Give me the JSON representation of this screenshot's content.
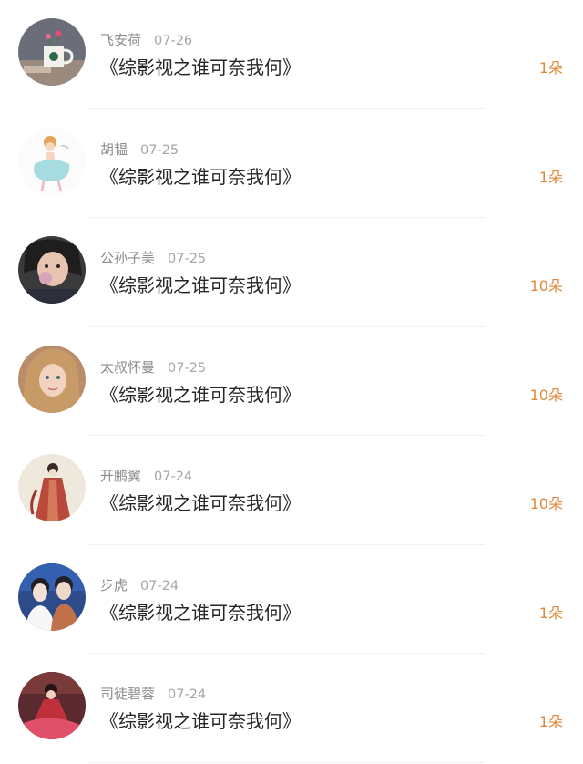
{
  "items": [
    {
      "name": "飞安荷",
      "date": "07-26",
      "title": "《综影视之谁可奈我何》",
      "count": "1朵",
      "avatar": "avatar-coffee-cup-icon"
    },
    {
      "name": "胡韫",
      "date": "07-25",
      "title": "《综影视之谁可奈我何》",
      "count": "1朵",
      "avatar": "avatar-cartoon-girl-icon"
    },
    {
      "name": "公孙子美",
      "date": "07-25",
      "title": "《综影视之谁可奈我何》",
      "count": "10朵",
      "avatar": "avatar-child-photo-icon"
    },
    {
      "name": "太叔怀曼",
      "date": "07-25",
      "title": "《综影视之谁可奈我何》",
      "count": "10朵",
      "avatar": "avatar-blonde-girl-icon"
    },
    {
      "name": "开鹏翼",
      "date": "07-24",
      "title": "《综影视之谁可奈我何》",
      "count": "10朵",
      "avatar": "avatar-ancient-painting-icon"
    },
    {
      "name": "步虎",
      "date": "07-24",
      "title": "《综影视之谁可奈我何》",
      "count": "1朵",
      "avatar": "avatar-two-people-icon"
    },
    {
      "name": "司徒碧蓉",
      "date": "07-24",
      "title": "《综影视之谁可奈我何》",
      "count": "1朵",
      "avatar": "avatar-red-dress-icon"
    }
  ],
  "colors": {
    "accent_count": "#e0883a",
    "title_text": "#262626",
    "meta_text": "#8c8c8c",
    "divider": "#f1f1f1"
  }
}
